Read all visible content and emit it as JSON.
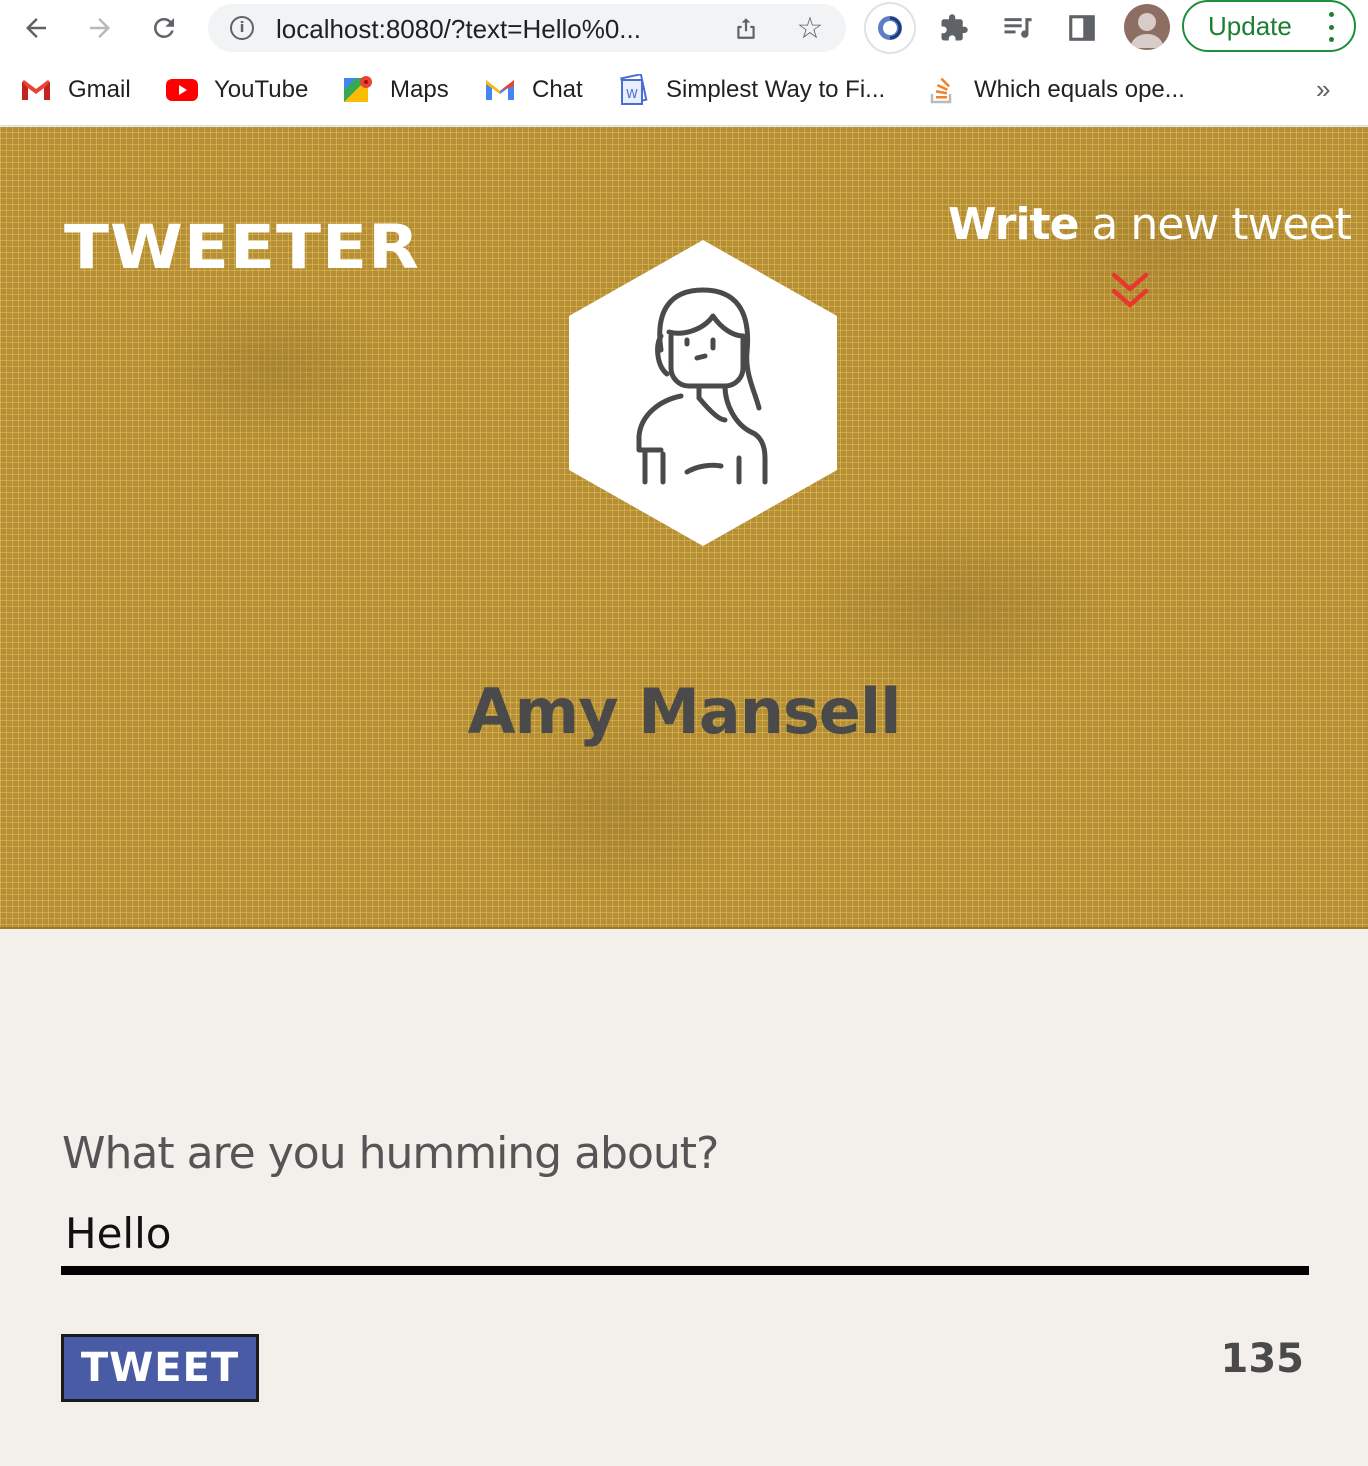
{
  "browser": {
    "url": "localhost:8080/?text=Hello%0...",
    "update_label": "Update",
    "bookmarks": [
      {
        "label": "Gmail",
        "icon": "gmail-icon"
      },
      {
        "label": "YouTube",
        "icon": "youtube-icon"
      },
      {
        "label": "Maps",
        "icon": "maps-icon"
      },
      {
        "label": "Chat",
        "icon": "chat-icon"
      },
      {
        "label": "Simplest Way to Fi...",
        "icon": "docs-icon"
      },
      {
        "label": "Which equals ope...",
        "icon": "stackoverflow-icon"
      }
    ],
    "more_label": "»"
  },
  "header": {
    "brand": "TWEETER",
    "write_bold": "Write",
    "write_rest": " a new tweet",
    "user_name": "Amy Mansell",
    "accent_color": "#e8382d"
  },
  "compose": {
    "label": "What are you humming about?",
    "value": "Hello",
    "button_label": "TWEET",
    "char_count": "135"
  }
}
